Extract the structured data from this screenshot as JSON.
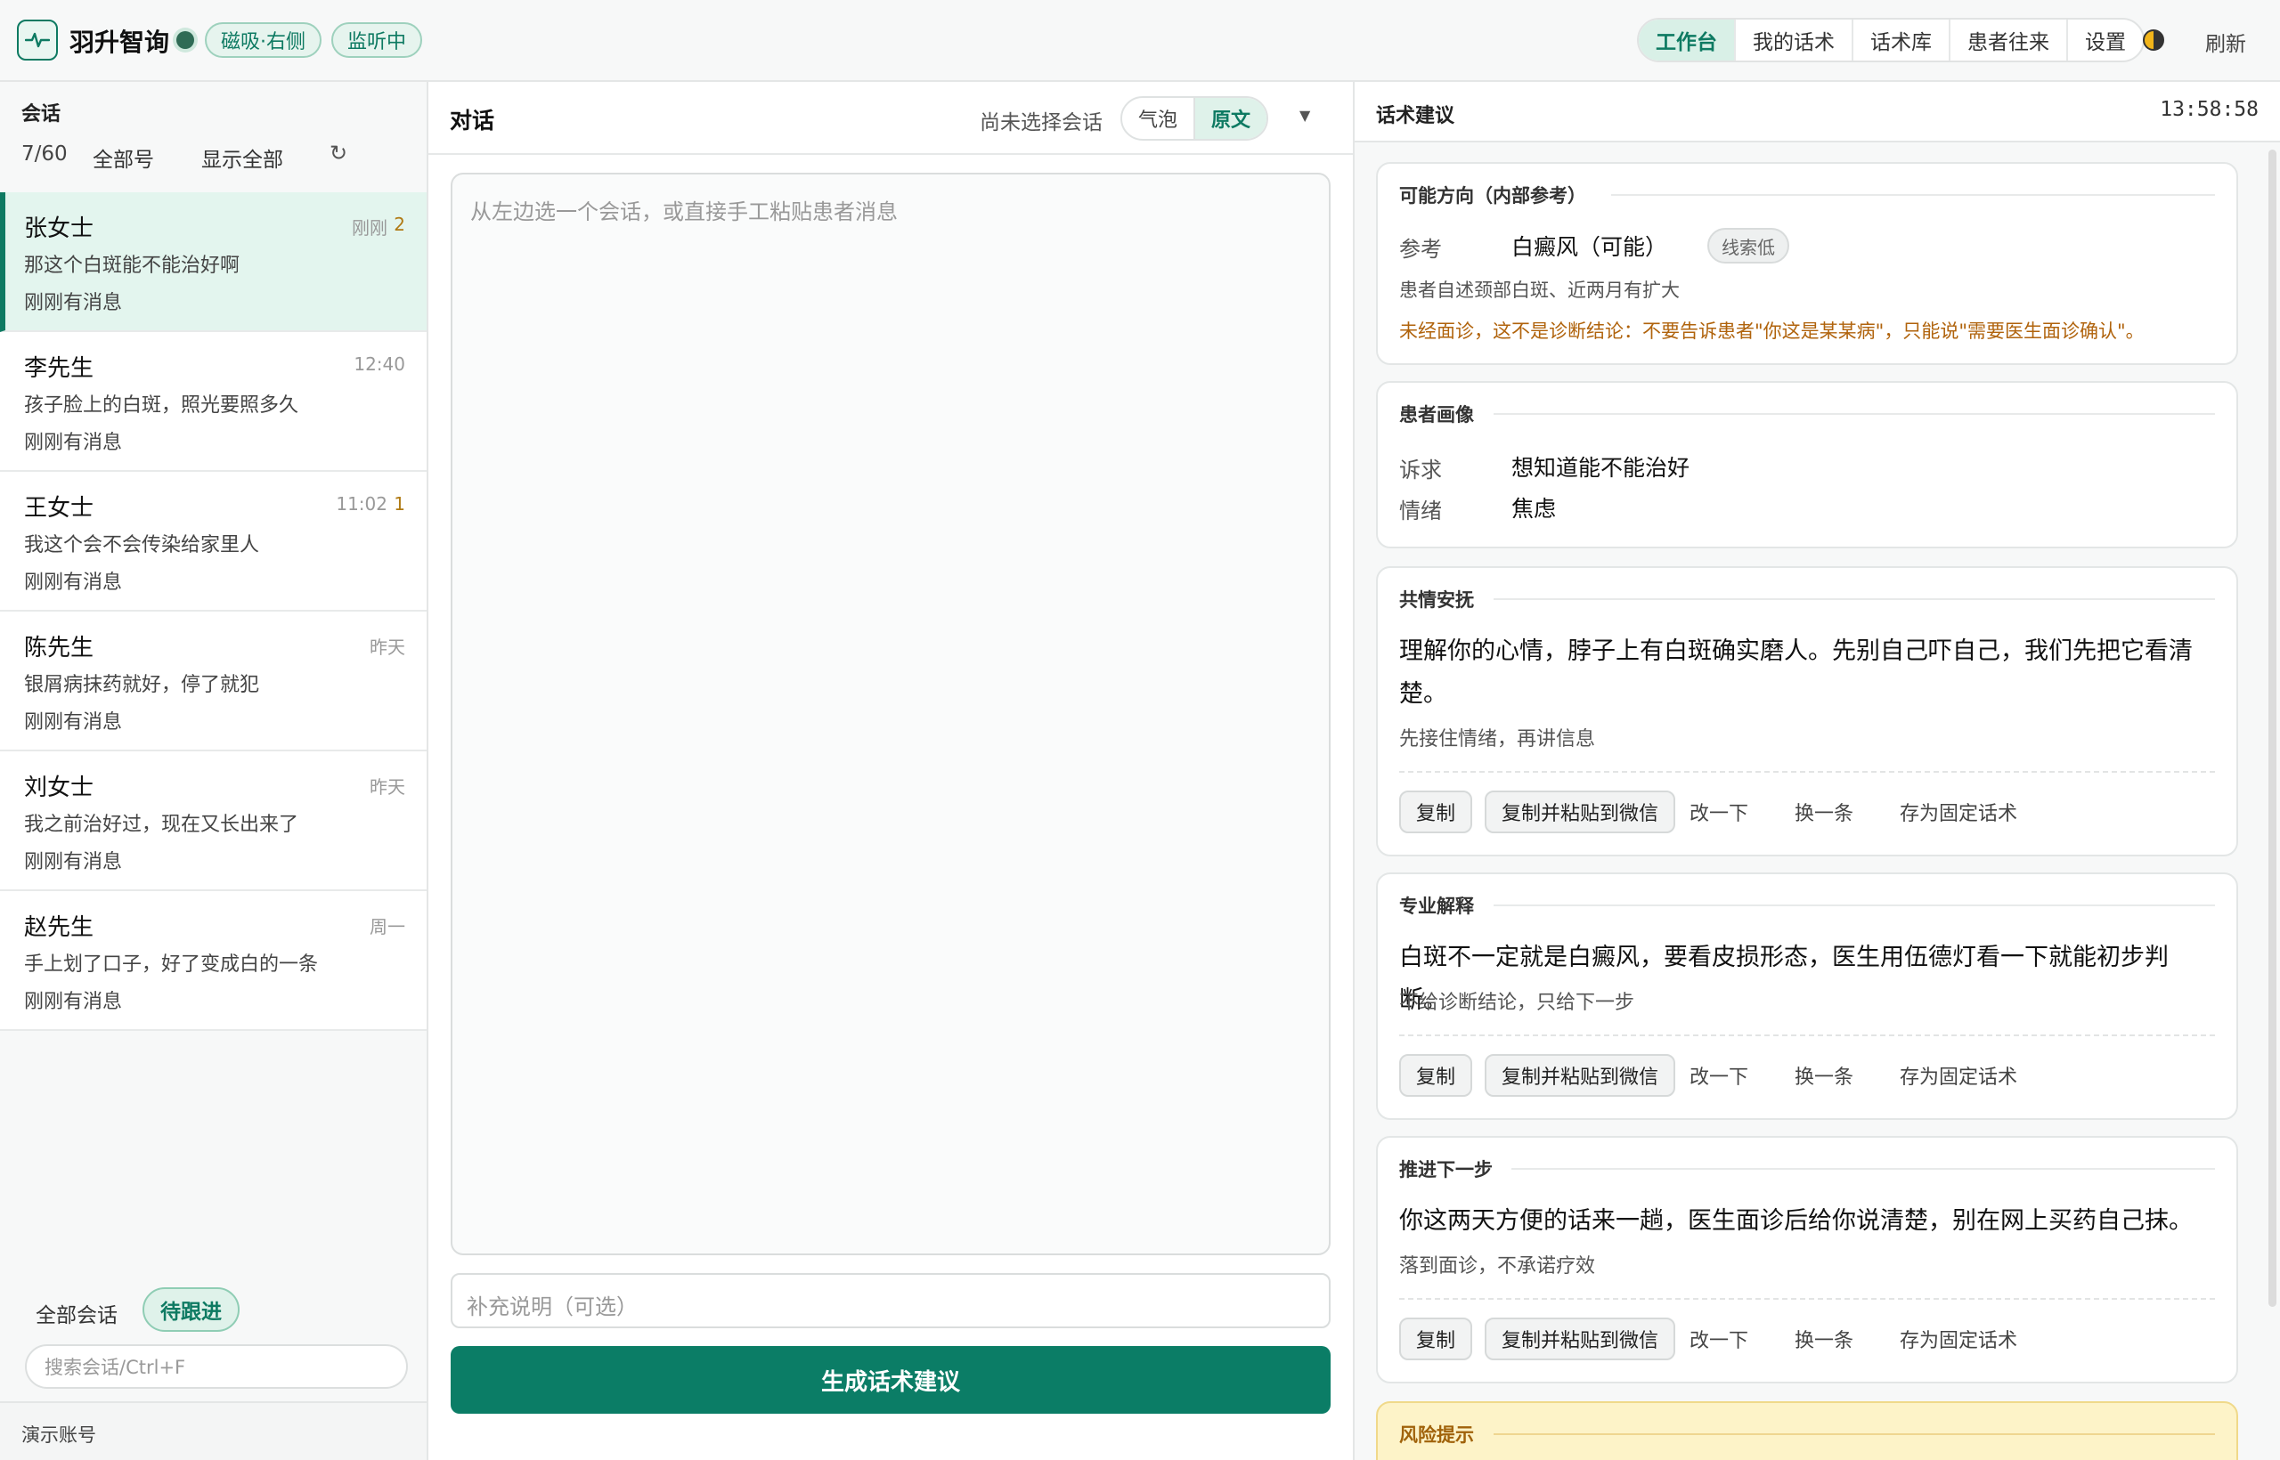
{
  "app": {
    "title": "羽升智询",
    "mode_pill": "磁吸·右侧",
    "listening_pill": "监听中",
    "nav": [
      "工作台",
      "我的话术",
      "话术库",
      "患者往来",
      "设置"
    ],
    "nav_active": "工作台",
    "refresh": "刷新",
    "accent": "#0e7a62"
  },
  "sidebar": {
    "title": "会话",
    "count": "7/60",
    "account_filter": "全部号",
    "show_all": "显示全部",
    "conversations": [
      {
        "name": "张女士",
        "message": "那这个白斑能不能治好啊",
        "status": "刚刚有消息",
        "time": "刚刚",
        "badge": "2",
        "active": true
      },
      {
        "name": "李先生",
        "message": "孩子脸上的白斑，照光要照多久",
        "status": "刚刚有消息",
        "time": "12:40",
        "badge": ""
      },
      {
        "name": "王女士",
        "message": "我这个会不会传染给家里人",
        "status": "刚刚有消息",
        "time": "11:02",
        "badge": "1"
      },
      {
        "name": "陈先生",
        "message": "银屑病抹药就好，停了就犯",
        "status": "刚刚有消息",
        "time": "昨天",
        "badge": ""
      },
      {
        "name": "刘女士",
        "message": "我之前治好过，现在又长出来了",
        "status": "刚刚有消息",
        "time": "昨天",
        "badge": ""
      },
      {
        "name": "赵先生",
        "message": "手上划了口子，好了变成白的一条",
        "status": "刚刚有消息",
        "time": "周一",
        "badge": ""
      }
    ],
    "filter_all": "全部会话",
    "filter_pending": "待跟进",
    "search_placeholder": "搜索会话/Ctrl+F",
    "account": "演示账号"
  },
  "chat": {
    "title": "对话",
    "no_selection": "尚未选择会话",
    "view_bubble": "气泡",
    "view_raw": "原文",
    "placeholder": "从左边选一个会话，或直接手工粘贴患者消息",
    "note_placeholder": "补充说明（可选）",
    "generate": "生成话术建议"
  },
  "suggestions": {
    "title": "话术建议",
    "clock": "13:58:58",
    "direction": {
      "label": "可能方向（内部参考）",
      "ref_key": "参考",
      "ref_value": "白癜风（可能）",
      "ref_tag": "线索低",
      "desc": "患者自述颈部白斑、近两月有扩大",
      "warning": "未经面诊，这不是诊断结论：不要告诉患者\"你这是某某病\"，只能说\"需要医生面诊确认\"。"
    },
    "profile": {
      "label": "患者画像",
      "items": [
        {
          "key": "诉求",
          "value": "想知道能不能治好"
        },
        {
          "key": "情绪",
          "value": "焦虑"
        }
      ]
    },
    "cards": [
      {
        "label": "共情安抚",
        "text": "理解你的心情，脖子上有白斑确实磨人。先别自己吓自己，我们先把它看清楚。",
        "note": "先接住情绪，再讲信息"
      },
      {
        "label": "专业解释",
        "text": "白斑不一定就是白癜风，要看皮损形态，医生用伍德灯看一下就能初步判断。",
        "note": "不给诊断结论，只给下一步"
      },
      {
        "label": "推进下一步",
        "text": "你这两天方便的话来一趟，医生面诊后给你说清楚，别在网上买药自己抹。",
        "note": "落到面诊，不承诺疗效"
      }
    ],
    "actions": {
      "copy": "复制",
      "copy_paste": "复制并粘贴到微信",
      "edit": "改一下",
      "swap": "换一条",
      "save": "存为固定话术"
    },
    "risk_label": "风险提示"
  }
}
